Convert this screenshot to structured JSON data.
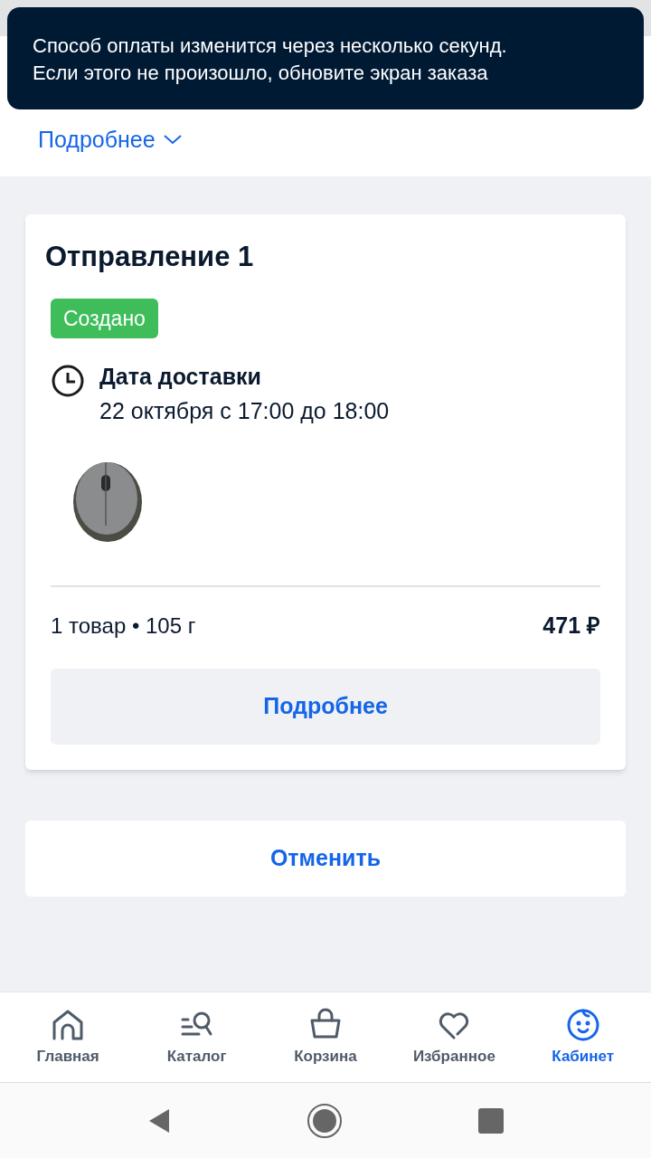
{
  "toast": {
    "lines": [
      "Способ оплаты изменится через несколько секунд.",
      "Если этого не произошло, обновите экран заказа"
    ]
  },
  "details_link": {
    "label": "Подробнее"
  },
  "shipment": {
    "title": "Отправление 1",
    "status": "Создано",
    "delivery_label": "Дата доставки",
    "delivery_time": "22 октября с 17:00 до 18:00",
    "summary": "1 товар • 105 г",
    "price": "471 ₽",
    "details_button": "Подробнее"
  },
  "cancel_button": "Отменить",
  "bottom_nav": [
    {
      "kind": "home",
      "label": "Главная",
      "selected": false
    },
    {
      "kind": "catalog",
      "label": "Каталог",
      "selected": false
    },
    {
      "kind": "cart",
      "label": "Корзина",
      "selected": false
    },
    {
      "kind": "favorites",
      "label": "Избранное",
      "selected": false
    },
    {
      "kind": "profile",
      "label": "Кабинет",
      "selected": true
    }
  ]
}
